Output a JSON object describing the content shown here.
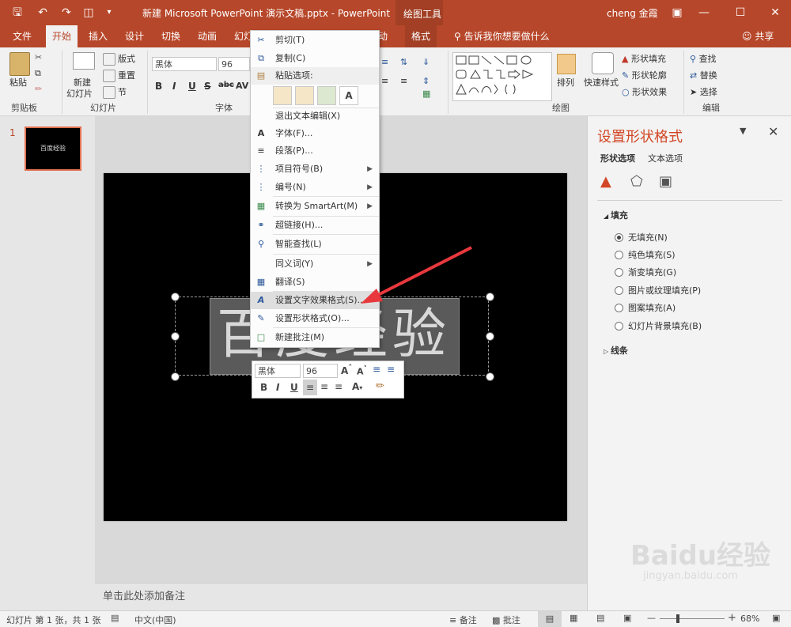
{
  "titlebar": {
    "doc_title": "新建 Microsoft PowerPoint 演示文稿.pptx  -  PowerPoint",
    "context_tab_group": "绘图工具",
    "user": "cheng 金霞"
  },
  "tabs": [
    "文件",
    "开始",
    "插入",
    "设计",
    "切换",
    "动画",
    "幻灯",
    "动",
    "格式"
  ],
  "tell_me": "告诉我你想要做什么",
  "share": "共享",
  "ribbon": {
    "clipboard": {
      "paste": "粘贴",
      "label": "剪贴板"
    },
    "slides": {
      "new_slide": "新建",
      "new_slide2": "幻灯片",
      "layout": "版式",
      "reset": "重置",
      "section": "节",
      "label": "幻灯片"
    },
    "font": {
      "font_name": "黑体",
      "font_size": "96",
      "bold": "B",
      "italic": "I",
      "underline": "U",
      "strike": "S",
      "shadow": "abc",
      "spacing": "AV",
      "label": "字体"
    },
    "drawing": {
      "arrange": "排列",
      "quick_styles": "快速样式",
      "fill": "形状填充",
      "outline": "形状轮廓",
      "effects": "形状效果",
      "label": "绘图"
    },
    "editing": {
      "find": "查找",
      "replace": "替换",
      "select": "选择",
      "label": "编辑"
    }
  },
  "thumbs": [
    {
      "num": "1",
      "text": "百度经验"
    }
  ],
  "slide": {
    "text": "百度经验"
  },
  "notes_placeholder": "单击此处添加备注",
  "context_menu": {
    "cut": "剪切(T)",
    "copy": "复制(C)",
    "paste_options": "粘贴选项:",
    "exit_edit": "退出文本编辑(X)",
    "font": "字体(F)...",
    "paragraph": "段落(P)...",
    "bullets": "项目符号(B)",
    "numbering": "编号(N)",
    "smartart": "转换为 SmartArt(M)",
    "hyperlink": "超链接(H)...",
    "smart_lookup": "智能查找(L)",
    "synonyms": "同义词(Y)",
    "translate": "翻译(S)",
    "format_text_effects": "设置文字效果格式(S)...",
    "format_shape": "设置形状格式(O)...",
    "new_comment": "新建批注(M)"
  },
  "mini_toolbar": {
    "font": "黑体",
    "size": "96",
    "bold": "B",
    "italic": "I",
    "underline": "U"
  },
  "format_pane": {
    "title": "设置形状格式",
    "tab_shape": "形状选项",
    "tab_text": "文本选项",
    "fill_section": "填充",
    "options": [
      "无填充(N)",
      "纯色填充(S)",
      "渐变填充(G)",
      "图片或纹理填充(P)",
      "图案填充(A)",
      "幻灯片背景填充(B)"
    ],
    "selected_index": 0,
    "line_section": "线条"
  },
  "status": {
    "slide_info": "幻灯片 第 1 张，共 1 张",
    "language": "中文(中国)",
    "notes": "备注",
    "comments": "批注",
    "zoom": "68%"
  },
  "watermark": {
    "brand": "Baidu经验",
    "url": "jingyan.baidu.com"
  },
  "colors": {
    "accent": "#b7472a",
    "pane_title": "#d24726"
  }
}
